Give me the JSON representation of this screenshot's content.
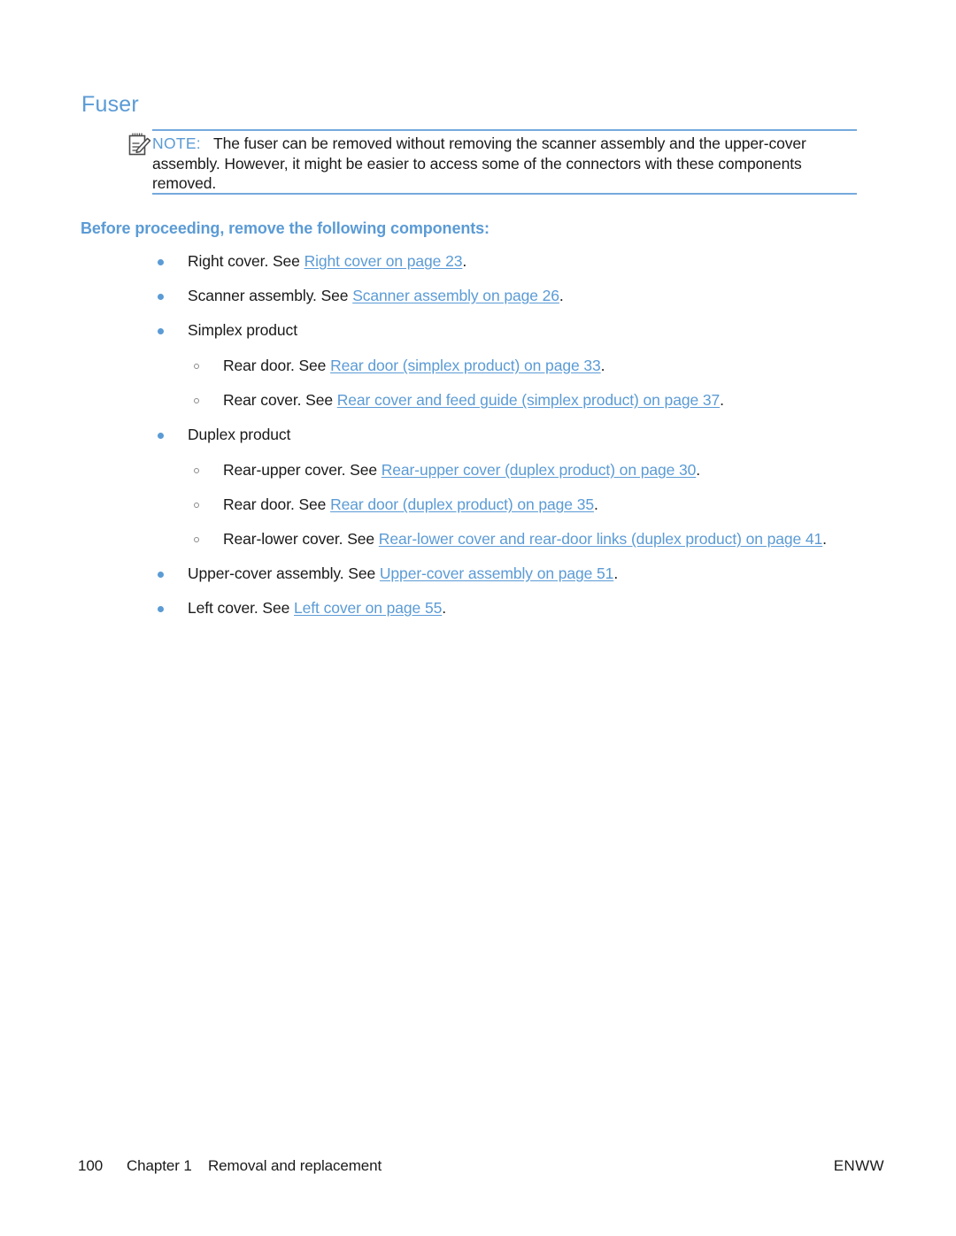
{
  "section": {
    "title": "Fuser"
  },
  "note": {
    "icon": "note-pencil-icon",
    "label": "NOTE:",
    "text": "The fuser can be removed without removing the scanner assembly and the upper-cover assembly. However, it might be easier to access some of the connectors with these components removed.",
    "rule_color": "#76a9dd",
    "label_color": "#5b9bd5"
  },
  "lead_heading": "Before proceeding, remove the following components:",
  "list": [
    {
      "level": 1,
      "marker": "bullet-filled",
      "pre": "Right cover. See ",
      "link": "Right cover on page 23",
      "post": "."
    },
    {
      "level": 1,
      "marker": "bullet-filled",
      "pre": "Scanner assembly. See ",
      "link": "Scanner assembly on page 26",
      "post": "."
    },
    {
      "level": 1,
      "marker": "bullet-filled",
      "pre": "Simplex product",
      "link": "",
      "post": ""
    },
    {
      "level": 2,
      "marker": "bullet-hollow",
      "pre": "Rear door. See ",
      "link": "Rear door (simplex product) on page 33",
      "post": "."
    },
    {
      "level": 2,
      "marker": "bullet-hollow",
      "pre": "Rear cover. See ",
      "link": "Rear cover and feed guide (simplex product) on page 37",
      "post": "."
    },
    {
      "level": 1,
      "marker": "bullet-filled",
      "pre": "Duplex product",
      "link": "",
      "post": ""
    },
    {
      "level": 2,
      "marker": "bullet-hollow",
      "pre": "Rear-upper cover. See ",
      "link": "Rear-upper cover (duplex product) on page 30",
      "post": "."
    },
    {
      "level": 2,
      "marker": "bullet-hollow",
      "pre": "Rear door. See ",
      "link": "Rear door (duplex product) on page 35",
      "post": "."
    },
    {
      "level": 2,
      "marker": "bullet-hollow",
      "pre": "Rear-lower cover. See ",
      "link": "Rear-lower cover and rear-door links (duplex product) on page 41",
      "post": "."
    },
    {
      "level": 1,
      "marker": "bullet-filled",
      "pre": "Upper-cover assembly. See ",
      "link": "Upper-cover assembly on page 51",
      "post": "."
    },
    {
      "level": 1,
      "marker": "bullet-filled",
      "pre": "Left cover. See ",
      "link": "Left cover on page 55",
      "post": "."
    }
  ],
  "footer": {
    "page_number": "100",
    "chapter": "Chapter 1",
    "chapter_title": "Removal and replacement",
    "publication": "ENWW"
  },
  "colors": {
    "accent_blue": "#5b9bd5",
    "link_blue": "#5b9bd5",
    "text": "#1a1a1a",
    "background": "#ffffff"
  }
}
